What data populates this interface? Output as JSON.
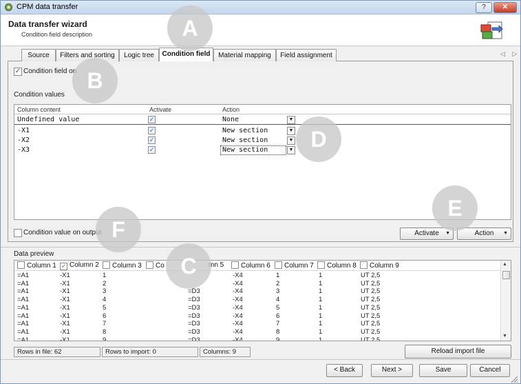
{
  "window": {
    "title": "CPM data transfer",
    "help_label": "?",
    "close_label": "✕"
  },
  "header": {
    "title": "Data transfer wizard",
    "subtitle": "Condition field description"
  },
  "tabs": [
    {
      "label": "Source",
      "active": false
    },
    {
      "label": "Filters and sorting",
      "active": false
    },
    {
      "label": "Logic tree",
      "active": false
    },
    {
      "label": "Condition field",
      "active": true
    },
    {
      "label": "Material mapping",
      "active": false
    },
    {
      "label": "Field assignment",
      "active": false
    }
  ],
  "tab_scroll_arrows": "◁ ▷",
  "condition": {
    "field_on_label": "Condition field on",
    "field_on_checked": true,
    "values_label": "Condition values",
    "columns": [
      "Column content",
      "Activate",
      "Action"
    ],
    "rows": [
      {
        "content": "Undefined value",
        "activate": true,
        "action": "None"
      },
      {
        "content": "-X1",
        "activate": true,
        "action": "New section"
      },
      {
        "content": "-X2",
        "activate": true,
        "action": "New section"
      },
      {
        "content": "-X3",
        "activate": true,
        "action": "New section"
      }
    ],
    "value_on_output_label": "Condition value on output",
    "value_on_output_checked": false,
    "activate_button": "Activate",
    "action_button": "Action"
  },
  "preview": {
    "label": "Data preview",
    "columns": [
      {
        "label": "Column 1",
        "checked": false
      },
      {
        "label": "Column 2",
        "checked": true
      },
      {
        "label": "Column 3",
        "checked": false
      },
      {
        "label": "Co",
        "checked": false
      },
      {
        "label": "mn 5",
        "checked": false
      },
      {
        "label": "Column 6",
        "checked": false
      },
      {
        "label": "Column 7",
        "checked": false
      },
      {
        "label": "Column 8",
        "checked": false
      },
      {
        "label": "Column 9",
        "checked": false
      }
    ],
    "rows": [
      [
        "=A1",
        "-X1",
        "1",
        "",
        "-X4",
        "1",
        "1",
        "UT 2,5"
      ],
      [
        "=A1",
        "-X1",
        "2",
        "",
        "-X4",
        "2",
        "1",
        "UT 2,5"
      ],
      [
        "=A1",
        "-X1",
        "3",
        "=D3",
        "-X4",
        "3",
        "1",
        "UT 2,5"
      ],
      [
        "=A1",
        "-X1",
        "4",
        "=D3",
        "-X4",
        "4",
        "1",
        "UT 2,5"
      ],
      [
        "=A1",
        "-X1",
        "5",
        "=D3",
        "-X4",
        "5",
        "1",
        "UT 2,5"
      ],
      [
        "=A1",
        "-X1",
        "6",
        "=D3",
        "-X4",
        "6",
        "1",
        "UT 2,5"
      ],
      [
        "=A1",
        "-X1",
        "7",
        "=D3",
        "-X4",
        "7",
        "1",
        "UT 2,5"
      ],
      [
        "=A1",
        "-X1",
        "8",
        "=D3",
        "-X4",
        "8",
        "1",
        "UT 2,5"
      ],
      [
        "=A1",
        "-X1",
        "9",
        "=D3",
        "-X4",
        "9",
        "1",
        "UT 2,5"
      ]
    ]
  },
  "status": {
    "rows_in_file": "Rows in file: 62",
    "rows_to_import": "Rows to import: 0",
    "columns": "Columns: 9",
    "reload_button": "Reload import file"
  },
  "footer": {
    "back": "< Back",
    "next": "Next >",
    "save": "Save",
    "cancel": "Cancel"
  },
  "markers": [
    "A",
    "B",
    "C",
    "D",
    "E",
    "F"
  ],
  "colors": {
    "title_bar": "#c3d6ec",
    "close_button": "#c43b24",
    "checkmark": "#2a60b0",
    "marker": "#c8c8c8"
  }
}
